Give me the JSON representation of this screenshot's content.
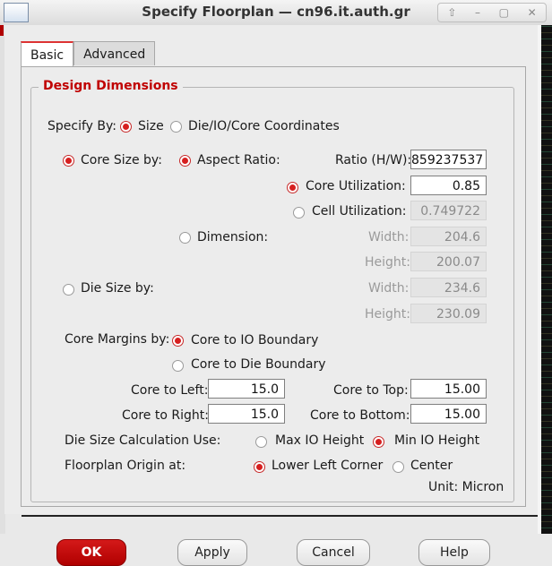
{
  "window": {
    "title": "Specify Floorplan — cn96.it.auth.gr"
  },
  "tabs": [
    {
      "label": "Basic"
    },
    {
      "label": "Advanced"
    }
  ],
  "group": {
    "title": "Design Dimensions"
  },
  "specify_by": {
    "label": "Specify By:",
    "options": [
      "Size",
      "Die/IO/Core Coordinates"
    ],
    "selected": "Size"
  },
  "core_size_by": {
    "label": "Core Size by:",
    "selected": true
  },
  "aspect_ratio": {
    "label": "Aspect Ratio:",
    "ratio_label": "Ratio (H/W):",
    "ratio_value": "859237537"
  },
  "core_utilization": {
    "label": "Core Utilization:",
    "value": "0.85"
  },
  "cell_utilization": {
    "label": "Cell Utilization:",
    "value": "0.749722"
  },
  "dimension": {
    "label": "Dimension:",
    "width_label": "Width:",
    "width_value": "204.6",
    "height_label": "Height:",
    "height_value": "200.07"
  },
  "die_size_by": {
    "label": "Die Size by:",
    "width_label": "Width:",
    "width_value": "234.6",
    "height_label": "Height:",
    "height_value": "230.09"
  },
  "core_margins": {
    "label": "Core Margins by:",
    "options": [
      "Core to IO Boundary",
      "Core to Die Boundary"
    ],
    "selected": "Core to IO Boundary"
  },
  "margins": {
    "left_label": "Core to Left:",
    "left_value": "15.0",
    "right_label": "Core to Right:",
    "right_value": "15.0",
    "top_label": "Core to Top:",
    "top_value": "15.00",
    "bottom_label": "Core to Bottom:",
    "bottom_value": "15.00"
  },
  "die_calc": {
    "label": "Die Size Calculation Use:",
    "options": [
      "Max IO Height",
      "Min IO Height"
    ],
    "selected": "Min IO Height"
  },
  "origin": {
    "label": "Floorplan Origin at:",
    "options": [
      "Lower Left Corner",
      "Center"
    ],
    "selected": "Lower Left Corner"
  },
  "unit": "Unit: Micron",
  "buttons": {
    "ok": "OK",
    "apply": "Apply",
    "cancel": "Cancel",
    "help": "Help"
  }
}
